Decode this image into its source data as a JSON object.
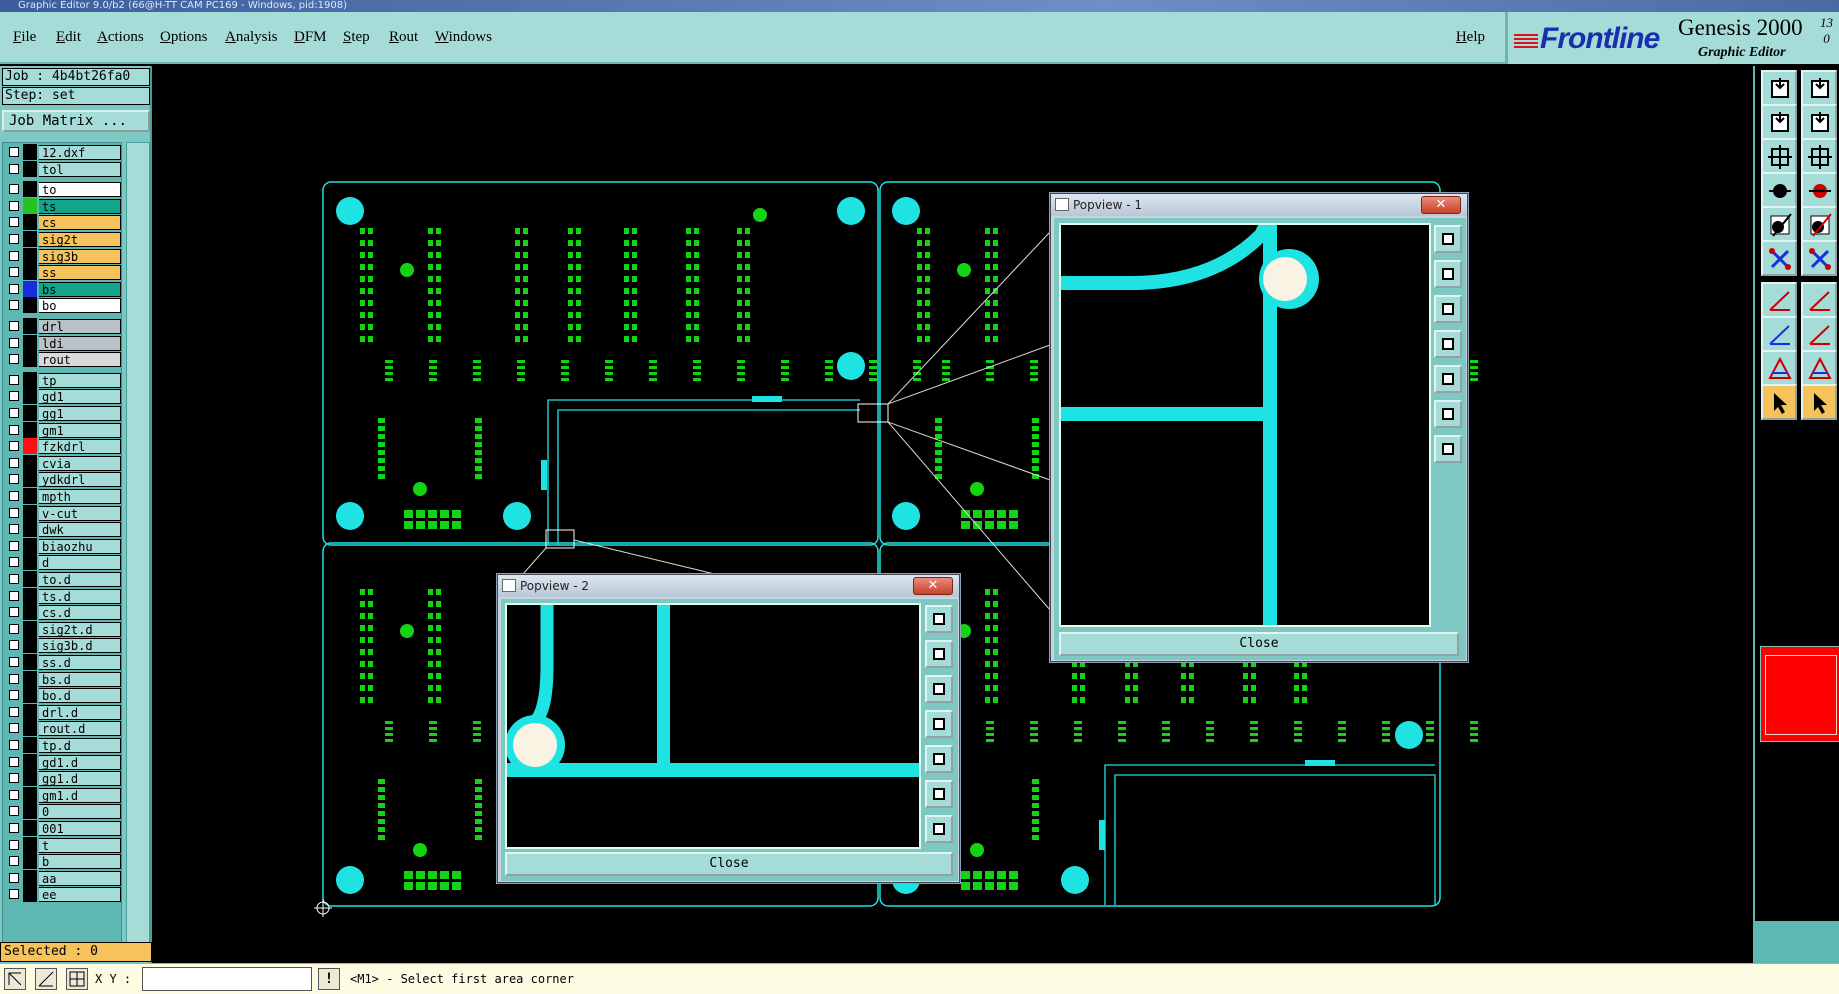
{
  "window_title": "Graphic Editor 9.0/b2 (66@H-TT CAM PC169 - Windows, pid:1908)",
  "menu": [
    "File",
    "Edit",
    "Actions",
    "Options",
    "Analysis",
    "DFM",
    "Step",
    "Rout",
    "Windows"
  ],
  "help": "Help",
  "brand": {
    "logo": "Frontline",
    "title": "Genesis 2000",
    "version_top": "13",
    "version_bottom": "0",
    "subtitle": "Graphic Editor"
  },
  "job_line": "Job : 4b4bt26fa0",
  "step_line": "Step: set",
  "job_matrix": "Job Matrix ...",
  "layers": [
    {
      "name": "12.dxf",
      "color": "#000000",
      "name_bg": "#a6dcd8"
    },
    {
      "name": "tol",
      "color": "#000000",
      "name_bg": "#a6dcd8"
    },
    {
      "name": "to",
      "color": "#000000",
      "name_bg": "#ffffff"
    },
    {
      "name": "ts",
      "color": "#22c322",
      "name_bg": "#12a58a"
    },
    {
      "name": "cs",
      "color": "#000000",
      "name_bg": "#f5c25c"
    },
    {
      "name": "sig2t",
      "color": "#000000",
      "name_bg": "#f5c25c"
    },
    {
      "name": "sig3b",
      "color": "#000000",
      "name_bg": "#f5c25c"
    },
    {
      "name": "ss",
      "color": "#000000",
      "name_bg": "#f5c25c"
    },
    {
      "name": "bs",
      "color": "#1a2fdc",
      "name_bg": "#12a58a"
    },
    {
      "name": "bo",
      "color": "#000000",
      "name_bg": "#ffffff"
    },
    {
      "name": "drl",
      "color": "#000000",
      "name_bg": "#b9c2c8"
    },
    {
      "name": "ldi",
      "color": "#000000",
      "name_bg": "#b9c2c8"
    },
    {
      "name": "rout",
      "color": "#000000",
      "name_bg": "#d9d9d9"
    },
    {
      "name": "tp",
      "color": "#000000",
      "name_bg": "#a6dcd8"
    },
    {
      "name": "gd1",
      "color": "#000000",
      "name_bg": "#a6dcd8"
    },
    {
      "name": "gg1",
      "color": "#000000",
      "name_bg": "#a6dcd8"
    },
    {
      "name": "gm1",
      "color": "#000000",
      "name_bg": "#a6dcd8"
    },
    {
      "name": "fzkdrl",
      "color": "#ff1010",
      "name_bg": "#a6dcd8"
    },
    {
      "name": "cvia",
      "color": "#000000",
      "name_bg": "#a6dcd8"
    },
    {
      "name": "ydkdrl",
      "color": "#000000",
      "name_bg": "#a6dcd8"
    },
    {
      "name": "mpth",
      "color": "#000000",
      "name_bg": "#a6dcd8"
    },
    {
      "name": "v-cut",
      "color": "#000000",
      "name_bg": "#a6dcd8"
    },
    {
      "name": "dwk",
      "color": "#000000",
      "name_bg": "#a6dcd8"
    },
    {
      "name": "biaozhu",
      "color": "#000000",
      "name_bg": "#a6dcd8"
    },
    {
      "name": "d",
      "color": "#000000",
      "name_bg": "#a6dcd8"
    },
    {
      "name": "to.d",
      "color": "#000000",
      "name_bg": "#a6dcd8"
    },
    {
      "name": "ts.d",
      "color": "#000000",
      "name_bg": "#a6dcd8"
    },
    {
      "name": "cs.d",
      "color": "#000000",
      "name_bg": "#a6dcd8"
    },
    {
      "name": "sig2t.d",
      "color": "#000000",
      "name_bg": "#a6dcd8"
    },
    {
      "name": "sig3b.d",
      "color": "#000000",
      "name_bg": "#a6dcd8"
    },
    {
      "name": "ss.d",
      "color": "#000000",
      "name_bg": "#a6dcd8"
    },
    {
      "name": "bs.d",
      "color": "#000000",
      "name_bg": "#a6dcd8"
    },
    {
      "name": "bo.d",
      "color": "#000000",
      "name_bg": "#a6dcd8"
    },
    {
      "name": "drl.d",
      "color": "#000000",
      "name_bg": "#a6dcd8"
    },
    {
      "name": "rout.d",
      "color": "#000000",
      "name_bg": "#a6dcd8"
    },
    {
      "name": "tp.d",
      "color": "#000000",
      "name_bg": "#a6dcd8"
    },
    {
      "name": "gd1.d",
      "color": "#000000",
      "name_bg": "#a6dcd8"
    },
    {
      "name": "gg1.d",
      "color": "#000000",
      "name_bg": "#a6dcd8"
    },
    {
      "name": "gm1.d",
      "color": "#000000",
      "name_bg": "#a6dcd8"
    },
    {
      "name": "0",
      "color": "#000000",
      "name_bg": "#a6dcd8"
    },
    {
      "name": "001",
      "color": "#000000",
      "name_bg": "#a6dcd8"
    },
    {
      "name": "t",
      "color": "#000000",
      "name_bg": "#a6dcd8"
    },
    {
      "name": "b",
      "color": "#000000",
      "name_bg": "#a6dcd8"
    },
    {
      "name": "aa",
      "color": "#000000",
      "name_bg": "#a6dcd8"
    },
    {
      "name": "ee",
      "color": "#000000",
      "name_bg": "#a6dcd8"
    }
  ],
  "selected": "Selected : 0",
  "status": {
    "xy_label": "X Y :",
    "xy_value": "",
    "prompt_button": "!",
    "prompt": "<M1> - Select first area corner"
  },
  "popview1": {
    "title": "Popview - 1",
    "close_x": "✕",
    "close_label": "Close"
  },
  "popview2": {
    "title": "Popview - 2",
    "close_x": "✕",
    "close_label": "Close"
  },
  "colors": {
    "board_outline": "#1fe3e3",
    "pads": "#1fe3e3",
    "smd": "#14d214",
    "highlight": "#f5c25c"
  }
}
